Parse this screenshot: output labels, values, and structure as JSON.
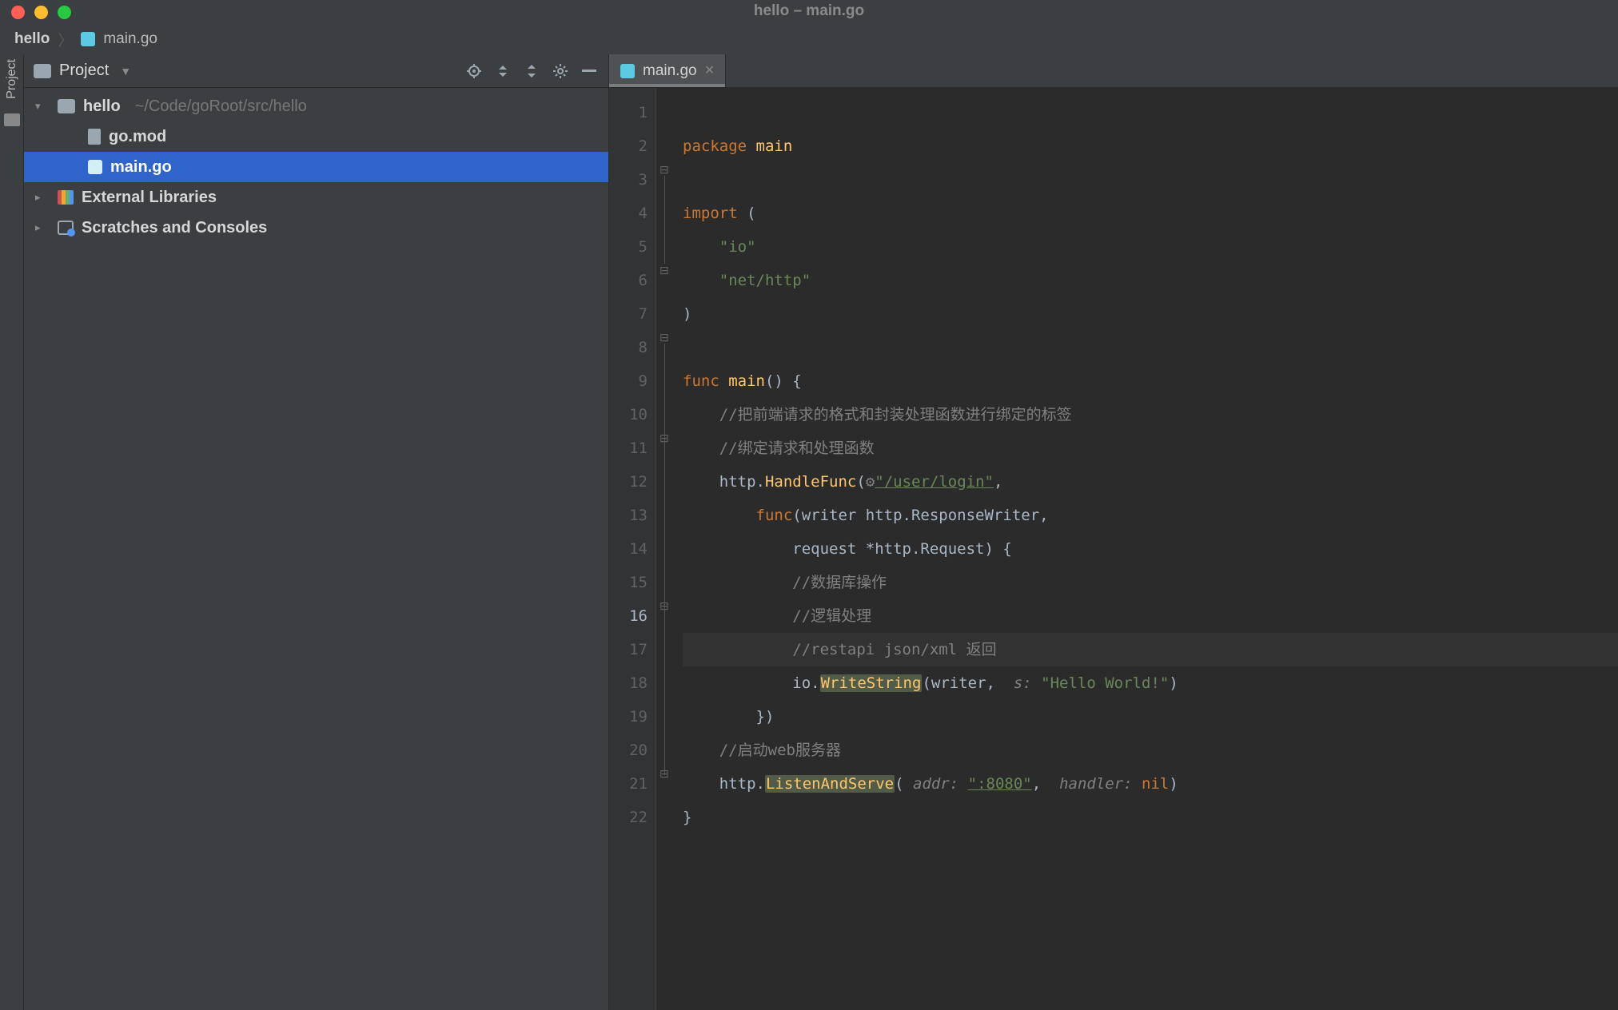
{
  "window": {
    "title": "hello – main.go"
  },
  "breadcrumb": {
    "root": "hello",
    "file": "main.go"
  },
  "toolstrip": {
    "project_label": "Project"
  },
  "project_panel": {
    "title": "Project",
    "root": {
      "name": "hello",
      "path": "~/Code/goRoot/src/hello"
    },
    "files": [
      {
        "name": "go.mod",
        "icon": "file"
      },
      {
        "name": "main.go",
        "icon": "gopher",
        "selected": true
      }
    ],
    "external_libraries": "External Libraries",
    "scratches": "Scratches and Consoles"
  },
  "tab": {
    "label": "main.go"
  },
  "line_numbers": [
    "1",
    "2",
    "3",
    "4",
    "5",
    "6",
    "7",
    "8",
    "9",
    "10",
    "11",
    "12",
    "13",
    "14",
    "15",
    "16",
    "17",
    "18",
    "19",
    "20",
    "21",
    "22"
  ],
  "current_line": 16,
  "run_line": 8,
  "code": {
    "l1_kw": "package",
    "l1_id": "main",
    "l3_kw": "import",
    "l3_p": "(",
    "l4_str": "\"io\"",
    "l5_str": "\"net/http\"",
    "l6_p": ")",
    "l8_kw": "func",
    "l8_id": "main",
    "l8_p": "() {",
    "l9_cmt": "//把前端请求的格式和封装处理函数进行绑定的标签",
    "l10_cmt": "//绑定请求和处理函数",
    "l11_a": "http.",
    "l11_fn": "HandleFunc",
    "l11_b": "(",
    "l11_gear": "⚙",
    "l11_str": "\"/user/login\"",
    "l11_c": ",",
    "l12_kw": "func",
    "l12_a": "(writer http.ResponseWriter,",
    "l13_a": "request *http.Request) {",
    "l14_cmt": "//数据库操作",
    "l15_cmt": "//逻辑处理",
    "l16_cmt": "//restapi json/xml 返回",
    "l17_a": "io.",
    "l17_fn": "WriteString",
    "l17_b": "(writer, ",
    "l17_param": " s: ",
    "l17_str": "\"Hello World!\"",
    "l17_c": ")",
    "l18_a": "})",
    "l19_cmt": "//启动web服务器",
    "l20_a": "http.",
    "l20_fn": "ListenAndServe",
    "l20_b": "(",
    "l20_p1": " addr: ",
    "l20_str": "\":8080\"",
    "l20_c": ", ",
    "l20_p2": " handler: ",
    "l20_nil": "nil",
    "l20_d": ")",
    "l21_a": "}"
  }
}
